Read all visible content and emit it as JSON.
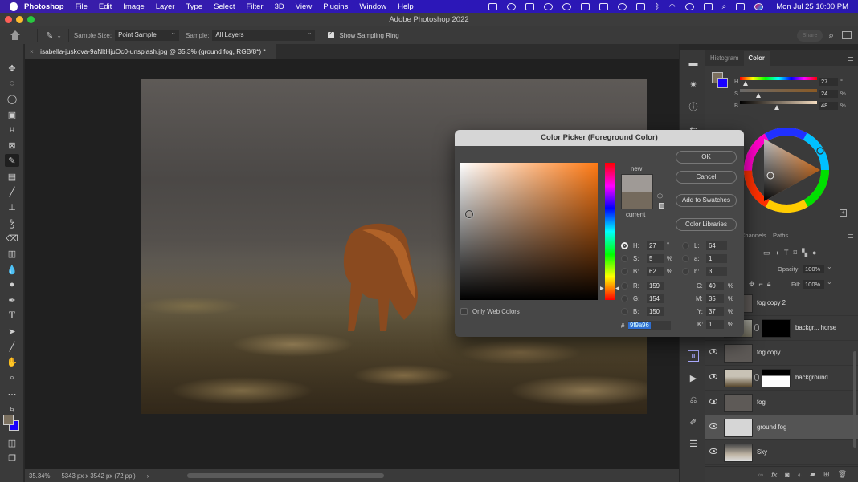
{
  "menubar": {
    "app": "Photoshop",
    "items": [
      "File",
      "Edit",
      "Image",
      "Layer",
      "Type",
      "Select",
      "Filter",
      "3D",
      "View",
      "Plugins",
      "Window",
      "Help"
    ],
    "status_icons": [
      "zoom-icon",
      "creative-cloud-icon",
      "dropbox-icon",
      "bars-icon",
      "screen-record-icon",
      "screen-share-icon",
      "bookmark-icon",
      "airplay-icon",
      "layout-icon",
      "bluetooth-icon",
      "wifi-icon",
      "user-icon",
      "keyboard-icon",
      "search-icon",
      "control-center-icon",
      "siri-icon"
    ],
    "clock": "Mon Jul 25  10:00 PM"
  },
  "window": {
    "title": "Adobe Photoshop 2022"
  },
  "options": {
    "sample_size_label": "Sample Size:",
    "sample_size_value": "Point Sample",
    "sample_label": "Sample:",
    "sample_value": "All Layers",
    "show_ring_label": "Show Sampling Ring",
    "show_ring_checked": true,
    "share_label": "Share"
  },
  "document": {
    "tab_label": "isabella-juskova-9aNltHjuOc0-unsplash.jpg @ 35.3% (ground fog, RGB/8*) *",
    "zoom": "35.34%",
    "dimensions": "5343 px x 3542 px (72 ppi)"
  },
  "tools": [
    "move",
    "marquee",
    "lasso",
    "object-select",
    "crop",
    "frame",
    "eyedropper",
    "healing",
    "brush",
    "stamp",
    "history-brush",
    "eraser",
    "gradient",
    "blur",
    "dodge",
    "pen",
    "type",
    "path-select",
    "line",
    "hand-rotate",
    "zoom",
    "more"
  ],
  "color_panel": {
    "tabs": [
      "Histogram",
      "Color"
    ],
    "active_tab": "Color",
    "foreground": "#7b705f",
    "background": "#1800ff",
    "h": {
      "label": "H",
      "value": "27",
      "unit": "°",
      "fraction": 0.075
    },
    "s": {
      "label": "S",
      "value": "24",
      "unit": "%",
      "fraction": 0.24
    },
    "b": {
      "label": "B",
      "value": "48",
      "unit": "%",
      "fraction": 0.48
    }
  },
  "color_picker": {
    "title": "Color Picker (Foreground Color)",
    "new_label": "new",
    "current_label": "current",
    "new_color": "#9f9a96",
    "current_color": "#746a5d",
    "buttons": {
      "ok": "OK",
      "cancel": "Cancel",
      "add_swatches": "Add to Swatches",
      "libraries": "Color Libraries"
    },
    "only_web_colors": "Only Web Colors",
    "fields": {
      "H": {
        "label": "H:",
        "value": "27",
        "unit": "°"
      },
      "S": {
        "label": "S:",
        "value": "5",
        "unit": "%"
      },
      "Bv": {
        "label": "B:",
        "value": "62",
        "unit": "%"
      },
      "R": {
        "label": "R:",
        "value": "159"
      },
      "G": {
        "label": "G:",
        "value": "154"
      },
      "Bl": {
        "label": "B:",
        "value": "150"
      },
      "L": {
        "label": "L:",
        "value": "64"
      },
      "a": {
        "label": "a:",
        "value": "1"
      },
      "bb": {
        "label": "b:",
        "value": "3"
      },
      "C": {
        "label": "C:",
        "value": "40",
        "unit": "%"
      },
      "M": {
        "label": "M:",
        "value": "35",
        "unit": "%"
      },
      "Y": {
        "label": "Y:",
        "value": "37",
        "unit": "%"
      },
      "K": {
        "label": "K:",
        "value": "1",
        "unit": "%"
      }
    },
    "hash": "#",
    "hex": "9f9a96"
  },
  "layers_panel": {
    "tabs": [
      "Channels",
      "Paths"
    ],
    "opacity_label": "Opacity:",
    "opacity": "100%",
    "fill_label": "Fill:",
    "fill": "100%",
    "layers": [
      {
        "name": "fog copy 2",
        "visible": false,
        "selected": false
      },
      {
        "name": "backgr... horse",
        "visible": false,
        "selected": false,
        "mask": true
      },
      {
        "name": "fog copy",
        "visible": true,
        "selected": false
      },
      {
        "name": "background",
        "visible": true,
        "selected": false,
        "mask": true
      },
      {
        "name": "fog",
        "visible": true,
        "selected": false
      },
      {
        "name": "ground fog",
        "visible": true,
        "selected": true
      },
      {
        "name": "Sky",
        "visible": true,
        "selected": false
      }
    ]
  }
}
